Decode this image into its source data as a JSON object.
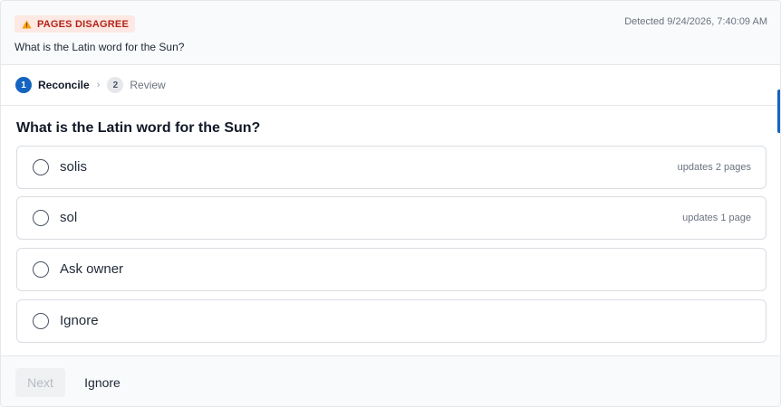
{
  "header": {
    "badge_label": "PAGES DISAGREE",
    "badge_icon": "warning-icon",
    "detected_text": "Detected 9/24/2026, 7:40:09 AM",
    "question": "What is the Latin word for the Sun?"
  },
  "stepper": {
    "steps": [
      {
        "number": "1",
        "label": "Reconcile",
        "state": "active"
      },
      {
        "number": "2",
        "label": "Review",
        "state": "inactive"
      }
    ],
    "separator": "›"
  },
  "main": {
    "question_title": "What is the Latin word for the Sun?",
    "options": [
      {
        "label": "solis",
        "meta": "updates 2 pages",
        "selected": false
      },
      {
        "label": "sol",
        "meta": "updates 1 page",
        "selected": false
      },
      {
        "label": "Ask owner",
        "meta": "",
        "selected": false
      },
      {
        "label": "Ignore",
        "meta": "",
        "selected": false
      }
    ]
  },
  "footer": {
    "next_label": "Next",
    "next_disabled": true,
    "ignore_label": "Ignore"
  },
  "colors": {
    "accent": "#1565c0",
    "badge_bg": "#fde8e3",
    "badge_text": "#b42318",
    "warning_icon": "#f59e0b"
  }
}
